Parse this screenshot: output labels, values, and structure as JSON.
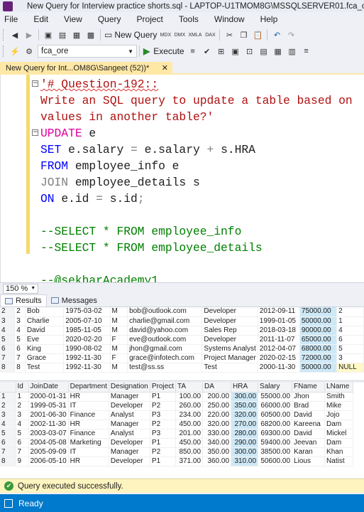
{
  "window": {
    "title": "New Query for Interview practice shorts.sql - LAPTOP-U1TMOM8G\\MSSQLSERVER01.fca_ore (LAPTOP"
  },
  "menu": [
    "File",
    "Edit",
    "View",
    "Query",
    "Project",
    "Tools",
    "Window",
    "Help"
  ],
  "toolbar": {
    "new_query_label": "New Query",
    "database": "fca_ore",
    "execute_label": "Execute"
  },
  "editor_tab": {
    "label": "New Query for Int...OM8G\\Sangeet (52))*",
    "close": "✕"
  },
  "code": [
    {
      "fold": "−",
      "parts": [
        {
          "t": "'# Question-192::",
          "c": "str squig"
        }
      ]
    },
    {
      "fold": "",
      "parts": [
        {
          "t": "Write an SQL query to update a table based on",
          "c": "str"
        }
      ]
    },
    {
      "fold": "",
      "parts": [
        {
          "t": "values in another table?'",
          "c": "str"
        }
      ]
    },
    {
      "fold": "−",
      "parts": [
        {
          "t": "UPDATE",
          "c": "pink"
        },
        {
          "t": " e",
          "c": "plain"
        }
      ]
    },
    {
      "fold": "",
      "parts": [
        {
          "t": "SET",
          "c": "kw"
        },
        {
          "t": " e.salary ",
          "c": "plain"
        },
        {
          "t": "=",
          "c": "gray"
        },
        {
          "t": " e.salary ",
          "c": "plain"
        },
        {
          "t": "+",
          "c": "gray"
        },
        {
          "t": " s.HRA",
          "c": "plain"
        }
      ]
    },
    {
      "fold": "",
      "parts": [
        {
          "t": "FROM",
          "c": "kw"
        },
        {
          "t": " employee_info e",
          "c": "plain"
        }
      ]
    },
    {
      "fold": "",
      "parts": [
        {
          "t": "JOIN",
          "c": "gray"
        },
        {
          "t": " employee_details s",
          "c": "plain"
        }
      ]
    },
    {
      "fold": "",
      "parts": [
        {
          "t": "ON",
          "c": "kw"
        },
        {
          "t": " e.id ",
          "c": "plain"
        },
        {
          "t": "=",
          "c": "gray"
        },
        {
          "t": " s.id",
          "c": "plain"
        },
        {
          "t": ";",
          "c": "gray"
        }
      ]
    },
    {
      "fold": "",
      "parts": []
    },
    {
      "fold": "",
      "parts": [
        {
          "t": "--SELECT * FROM employee_info",
          "c": "cmt"
        }
      ]
    },
    {
      "fold": "",
      "parts": [
        {
          "t": "--SELECT * FROM employee_details",
          "c": "cmt"
        }
      ]
    },
    {
      "fold": "",
      "parts": []
    },
    {
      "fold": "",
      "parts": [
        {
          "t": "--@sekharAcademy1",
          "c": "cmt"
        }
      ]
    }
  ],
  "zoom": "150 %",
  "result_tabs": {
    "results": "Results",
    "messages": "Messages"
  },
  "grid1": {
    "rows": [
      [
        "2",
        "2",
        "Bob",
        "1975-03-02",
        "M",
        "bob@outlook.com",
        "Developer",
        "2012-09-11",
        "75000.00",
        "2"
      ],
      [
        "3",
        "3",
        "Charlie",
        "2005-07-10",
        "M",
        "charlie@gmail.com",
        "Developer",
        "1999-01-05",
        "50000.00",
        "1"
      ],
      [
        "4",
        "4",
        "David",
        "1985-11-05",
        "M",
        "david@yahoo.com",
        "Sales Rep",
        "2018-03-18",
        "90000.00",
        "4"
      ],
      [
        "5",
        "5",
        "Eve",
        "2020-02-20",
        "F",
        "eve@outlook.com",
        "Developer",
        "2011-11-07",
        "65000.00",
        "6"
      ],
      [
        "6",
        "6",
        "King",
        "1990-08-02",
        "M",
        "jhon@gmail.com",
        "Systems Analyst",
        "2012-04-07",
        "68000.00",
        "5"
      ],
      [
        "7",
        "7",
        "Grace",
        "1992-11-30",
        "F",
        "grace@infotech.com",
        "Project Manager",
        "2020-02-15",
        "72000.00",
        "3"
      ],
      [
        "8",
        "8",
        "Test",
        "1992-11-30",
        "M",
        "test@ss.ss",
        "Test",
        "2000-11-30",
        "50000.00",
        "NULL"
      ]
    ]
  },
  "grid2": {
    "headers": [
      "",
      "Id",
      "JoinDate",
      "Department",
      "Designation",
      "Project",
      "TA",
      "DA",
      "HRA",
      "Salary",
      "FName",
      "LName"
    ],
    "rows": [
      [
        "1",
        "1",
        "2000-01-31",
        "HR",
        "Manager",
        "P1",
        "100.00",
        "200.00",
        "300.00",
        "55000.00",
        "Jhon",
        "Smith"
      ],
      [
        "2",
        "2",
        "1999-05-31",
        "IT",
        "Developer",
        "P2",
        "260.00",
        "250.00",
        "350.00",
        "66000.00",
        "Brad",
        "Mike"
      ],
      [
        "3",
        "3",
        "2001-06-30",
        "Finance",
        "Analyst",
        "P3",
        "234.00",
        "220.00",
        "320.00",
        "60500.00",
        "David",
        "Jojo"
      ],
      [
        "4",
        "4",
        "2002-11-30",
        "HR",
        "Manager",
        "P2",
        "450.00",
        "320.00",
        "270.00",
        "68200.00",
        "Kareena",
        "Dam"
      ],
      [
        "5",
        "5",
        "2003-03-07",
        "Finance",
        "Analyst",
        "P3",
        "201.00",
        "330.00",
        "280.00",
        "69300.00",
        "David",
        "Mickel"
      ],
      [
        "6",
        "6",
        "2004-05-08",
        "Marketing",
        "Developer",
        "P1",
        "450.00",
        "340.00",
        "290.00",
        "59400.00",
        "Jeevan",
        "Dam"
      ],
      [
        "7",
        "7",
        "2005-09-09",
        "IT",
        "Manager",
        "P2",
        "850.00",
        "350.00",
        "300.00",
        "38500.00",
        "Karan",
        "Khan"
      ],
      [
        "8",
        "9",
        "2006-05-10",
        "HR",
        "Developer",
        "P1",
        "371.00",
        "360.00",
        "310.00",
        "50600.00",
        "Lious",
        "Natist"
      ]
    ]
  },
  "status": {
    "message": "Query executed successfully.",
    "ready": "Ready"
  }
}
